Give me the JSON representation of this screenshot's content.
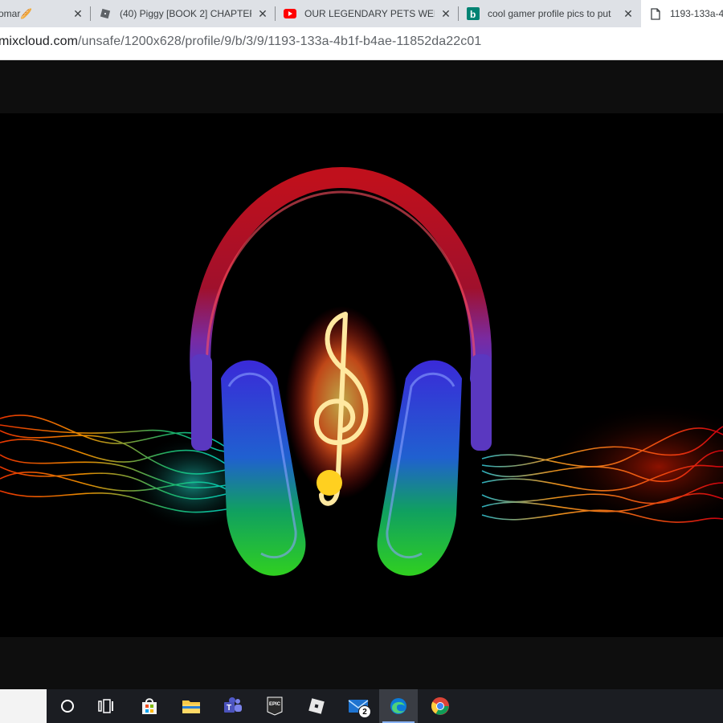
{
  "tabs": [
    {
      "title": "omar🥖",
      "icon": "user-avatar-icon",
      "active": false
    },
    {
      "title": "(40) Piggy [BOOK 2] CHAPTER",
      "icon": "roblox-icon",
      "active": false
    },
    {
      "title": "OUR LEGENDARY PETS WENT",
      "icon": "youtube-icon",
      "active": false
    },
    {
      "title": "cool gamer profile pics to put",
      "icon": "bing-icon",
      "active": false
    },
    {
      "title": "1193-133a-4",
      "icon": "document-icon",
      "active": true
    }
  ],
  "address_bar": {
    "host": "mixcloud.com",
    "path": "/unsafe/1200x628/profile/9/b/3/9/1193-133a-4b1f-b4ae-11852da22c01"
  },
  "taskbar": {
    "items": [
      {
        "name": "cortana-icon"
      },
      {
        "name": "task-view-icon"
      },
      {
        "name": "microsoft-store-icon"
      },
      {
        "name": "file-explorer-icon"
      },
      {
        "name": "teams-icon"
      },
      {
        "name": "epic-games-icon"
      },
      {
        "name": "roblox-icon"
      },
      {
        "name": "mail-icon"
      },
      {
        "name": "edge-icon"
      },
      {
        "name": "chrome-icon"
      }
    ],
    "mail_badge": "2",
    "epic_label": "EPIC"
  },
  "colors": {
    "youtube": "#ff0000",
    "bing": "#008373",
    "accent": "#8ab4f8"
  }
}
